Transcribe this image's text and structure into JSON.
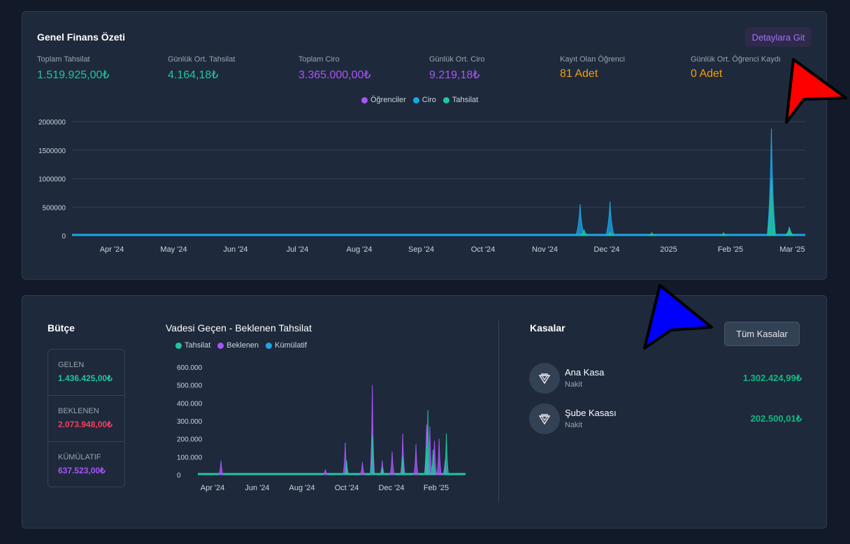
{
  "summary": {
    "title": "Genel Finans Özeti",
    "details_button": "Detaylara Git",
    "stats": [
      {
        "label": "Toplam Tahsilat",
        "value": "1.519.925,00₺",
        "color": "#22c5a0"
      },
      {
        "label": "Günlük Ort. Tahsilat",
        "value": "4.164,18₺",
        "color": "#22c5a0"
      },
      {
        "label": "Toplam Ciro",
        "value": "3.365.000,00₺",
        "color": "#a855f7"
      },
      {
        "label": "Günlük Ort. Ciro",
        "value": "9.219,18₺",
        "color": "#a855f7"
      },
      {
        "label": "Kayıt Olan Öğrenci",
        "value": "81 Adet",
        "color": "#f59e0b"
      },
      {
        "label": "Günlük Ort. Öğrenci Kaydı",
        "value": "0 Adet",
        "color": "#f59e0b"
      }
    ]
  },
  "budget": {
    "title": "Bütçe",
    "rows": [
      {
        "label": "GELEN",
        "value": "1.436.425,00₺",
        "color": "#22c5a0"
      },
      {
        "label": "BEKLENEN",
        "value": "2.073.948,00₺",
        "color": "#f43f5e"
      },
      {
        "label": "KÜMÜLATIF",
        "value": "637.523,00₺",
        "color": "#a855f7"
      }
    ]
  },
  "kasalar": {
    "title": "Kasalar",
    "all_button": "Tüm Kasalar",
    "items": [
      {
        "name": "Ana Kasa",
        "type": "Nakit",
        "amount": "1.302.424,99₺"
      },
      {
        "name": "Şube Kasası",
        "type": "Nakit",
        "amount": "202.500,01₺"
      }
    ]
  },
  "chart_data": [
    {
      "type": "area",
      "legend": [
        "Öğrenciler",
        "Ciro",
        "Tahsilat"
      ],
      "colors": {
        "Öğrenciler": "#a855f7",
        "Ciro": "#1aa7e8",
        "Tahsilat": "#22c5a0"
      },
      "ylim": [
        0,
        2000000
      ],
      "yticks": [
        "2000000",
        "1500000",
        "1000000",
        "500000",
        "0"
      ],
      "xticks": [
        "Apr '24",
        "May '24",
        "Jun '24",
        "Jul '24",
        "Aug '24",
        "Sep '24",
        "Oct '24",
        "Nov '24",
        "Dec '24",
        "2025",
        "Feb '25",
        "Mar '25"
      ],
      "x_range": [
        "2024-03-15",
        "2025-03-18"
      ],
      "series": [
        {
          "name": "Ciro",
          "points": [
            [
              "2024-11-25",
              550000
            ],
            [
              "2024-12-10",
              600000
            ],
            [
              "2025-01-05",
              20000
            ],
            [
              "2025-02-05",
              40000
            ],
            [
              "2025-03-01",
              1880000
            ],
            [
              "2025-03-10",
              150000
            ]
          ]
        },
        {
          "name": "Tahsilat",
          "points": [
            [
              "2024-11-27",
              100000
            ],
            [
              "2024-12-10",
              60000
            ],
            [
              "2024-12-31",
              50000
            ],
            [
              "2025-02-05",
              50000
            ],
            [
              "2025-03-01",
              1000000
            ],
            [
              "2025-03-10",
              150000
            ]
          ]
        }
      ]
    },
    {
      "type": "area",
      "title": "Vadesi Geçen - Beklenen Tahsilat",
      "legend": [
        "Tahsilat",
        "Beklenen",
        "Kümülatif"
      ],
      "colors": {
        "Tahsilat": "#22c5a0",
        "Beklenen": "#a855f7",
        "Kümülatif": "#1aa7e8"
      },
      "ylim": [
        0,
        600000
      ],
      "yticks": [
        "600.000",
        "500.000",
        "400.000",
        "300.000",
        "200.000",
        "100.000",
        "0"
      ],
      "xticks": [
        "Apr '24",
        "Jun '24",
        "Aug '24",
        "Oct '24",
        "Dec '24",
        "Feb '25"
      ],
      "x_range": [
        "2024-03-01",
        "2025-04-10"
      ],
      "series": [
        {
          "name": "Beklenen",
          "points": [
            [
              "2024-04-05",
              80000
            ],
            [
              "2024-09-10",
              30000
            ],
            [
              "2024-10-10",
              180000
            ],
            [
              "2024-11-05",
              70000
            ],
            [
              "2024-11-20",
              500000
            ],
            [
              "2024-12-05",
              80000
            ],
            [
              "2024-12-20",
              130000
            ],
            [
              "2025-01-05",
              230000
            ],
            [
              "2025-01-25",
              170000
            ],
            [
              "2025-02-10",
              280000
            ],
            [
              "2025-02-15",
              270000
            ],
            [
              "2025-02-22",
              190000
            ],
            [
              "2025-03-01",
              200000
            ],
            [
              "2025-03-10",
              80000
            ]
          ]
        },
        {
          "name": "Tahsilat",
          "points": [
            [
              "2024-10-12",
              80000
            ],
            [
              "2024-11-20",
              220000
            ],
            [
              "2024-12-05",
              40000
            ],
            [
              "2025-01-05",
              100000
            ],
            [
              "2025-02-10",
              160000
            ],
            [
              "2025-02-12",
              360000
            ],
            [
              "2025-02-20",
              140000
            ],
            [
              "2025-03-12",
              230000
            ]
          ]
        }
      ]
    }
  ]
}
